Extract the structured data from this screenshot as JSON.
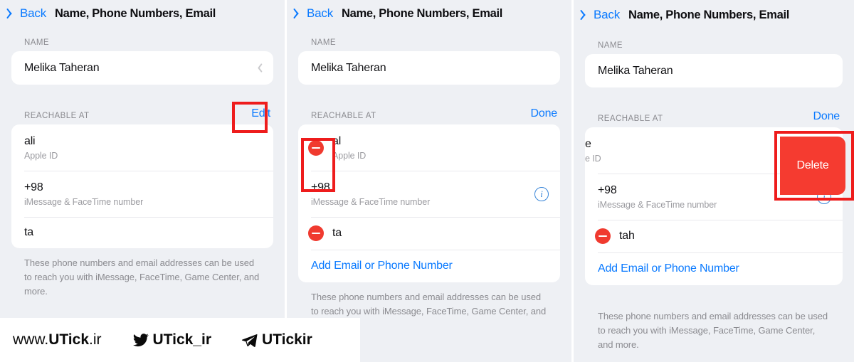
{
  "nav": {
    "back_label": "Back",
    "title": "Name, Phone Numbers, Email",
    "back_icon": "chevron-left-icon"
  },
  "colors": {
    "accent_blue": "#0a7aff",
    "destructive_red": "#f53b30",
    "annotation_red": "#ee1c1c",
    "background": "#eef0f4",
    "card": "#ffffff"
  },
  "sections": {
    "name_header": "NAME",
    "reachable_header": "REACHABLE AT",
    "name_value": "Melika Taheran",
    "edit_label": "Edit",
    "done_label": "Done",
    "add_label": "Add Email or Phone Number",
    "footnote": "These phone numbers and email addresses can be used to reach you with iMessage, FaceTime, Game Center, and more.",
    "delete_label": "Delete"
  },
  "panels": [
    {
      "id": "panel-1",
      "action_label": "Edit",
      "edit_mode": false,
      "rows": [
        {
          "title": "ali",
          "subtitle": "Apple ID",
          "accessory": "none",
          "has_minus": false
        },
        {
          "title": "+98",
          "subtitle": "iMessage & FaceTime number",
          "accessory": "none",
          "has_minus": false
        },
        {
          "title": "ta",
          "subtitle": "",
          "accessory": "none",
          "has_minus": false
        }
      ],
      "show_add_row": false,
      "annotation": "edit-button-highlight"
    },
    {
      "id": "panel-2",
      "action_label": "Done",
      "edit_mode": true,
      "rows": [
        {
          "title": "al",
          "subtitle": "Apple ID",
          "accessory": "none",
          "has_minus": true
        },
        {
          "title": "+98",
          "subtitle": "iMessage & FaceTime number",
          "accessory": "info",
          "has_minus": false
        },
        {
          "title": "ta",
          "subtitle": "",
          "accessory": "none",
          "has_minus": true
        }
      ],
      "show_add_row": true,
      "annotation": "minus-button-highlight"
    },
    {
      "id": "panel-3",
      "action_label": "Done",
      "edit_mode": true,
      "rows": [
        {
          "title": "e",
          "subtitle": "e ID",
          "accessory": "none",
          "has_minus": false
        },
        {
          "title": "+98 ",
          "subtitle": "iMessage & FaceTime number",
          "accessory": "info",
          "has_minus": false
        },
        {
          "title": "tah",
          "subtitle": "",
          "accessory": "none",
          "has_minus": true
        }
      ],
      "show_add_row": true,
      "annotation": "delete-button-highlight"
    }
  ],
  "watermark": {
    "site_prefix": "www.",
    "site_brand": "UTick",
    "site_suffix": ".ir",
    "twitter_handle": "UTick_ir",
    "telegram_handle": "UTickir",
    "twitter_icon": "twitter-bird-icon",
    "telegram_icon": "telegram-plane-icon"
  }
}
